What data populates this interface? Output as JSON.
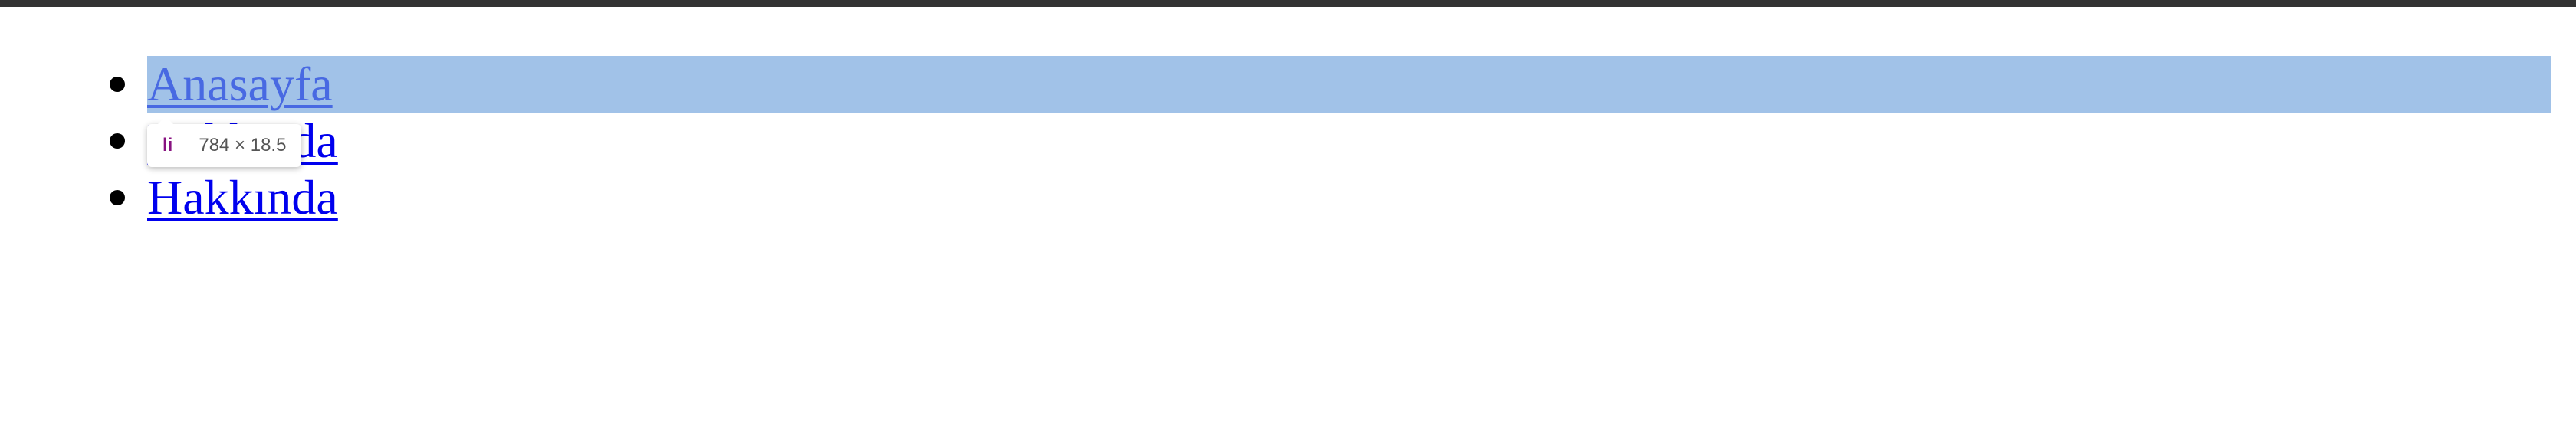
{
  "nav": {
    "items": [
      {
        "label": "Anasayfa"
      },
      {
        "label": "Hakkında"
      },
      {
        "label": "Hakkında"
      }
    ]
  },
  "devtools": {
    "tooltip": {
      "tag": "li",
      "dimensions": "784 × 18.5"
    },
    "highlight_color": "#a0c3e8"
  },
  "colors": {
    "link": "#0000ee",
    "top_bar": "#333333"
  }
}
